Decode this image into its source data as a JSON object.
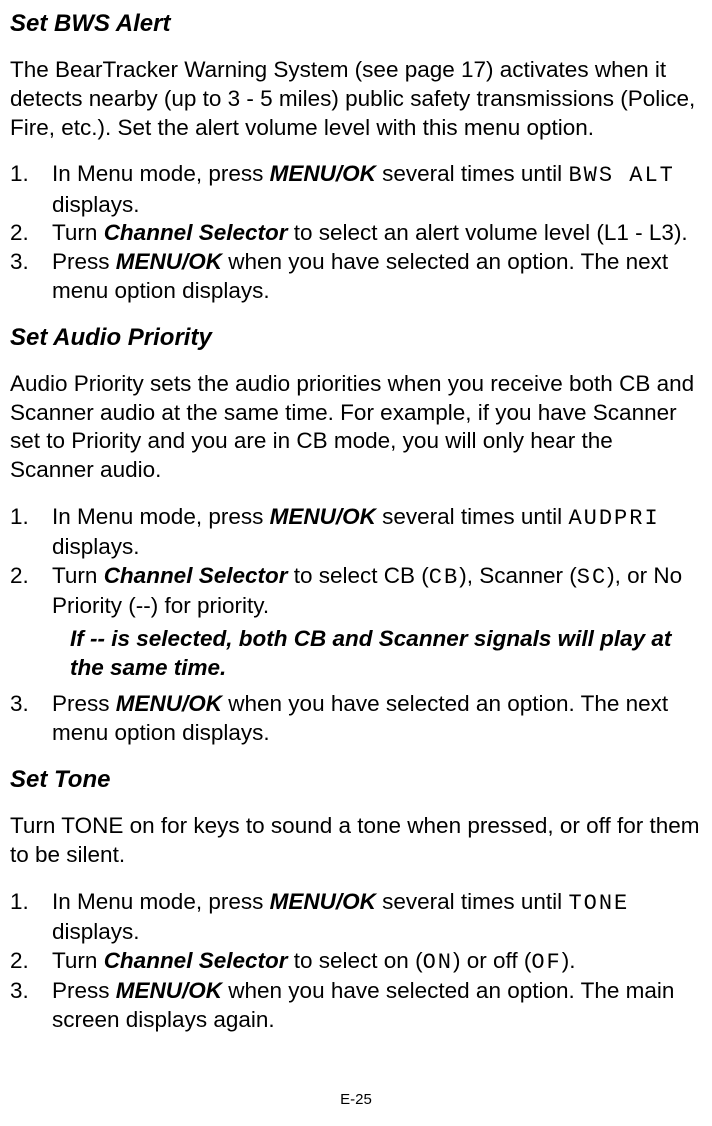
{
  "section1": {
    "heading": "Set BWS Alert",
    "intro": "The BearTracker Warning System (see page 17) activates when it detects nearby (up to 3 - 5 miles) public safety transmissions (Police, Fire, etc.). Set the alert volume level with this menu option.",
    "steps": [
      {
        "num": "1.",
        "pre": "In Menu mode, press ",
        "bi1": "MENU/OK",
        "mid": " several times until ",
        "lcd": "BWS ALT",
        "post": " displays."
      },
      {
        "num": "2.",
        "pre": "Turn ",
        "bi1": "Channel Selector",
        "post": " to select an alert volume level (L1 - L3)."
      },
      {
        "num": "3.",
        "pre": "Press ",
        "bi1": "MENU/OK",
        "post": " when you have selected an option. The next menu option  displays."
      }
    ]
  },
  "section2": {
    "heading": "Set Audio Priority",
    "intro": "Audio Priority sets the audio priorities when you receive both CB and Scanner audio at the same time. For example, if you have Scanner set to Priority and you are in CB mode, you will only hear the Scanner audio.",
    "step1": {
      "num": "1.",
      "pre": "In Menu mode, press ",
      "bi1": "MENU/OK",
      "mid": " several times until ",
      "lcd": "AUDPRI",
      "post": " displays."
    },
    "step2": {
      "num": "2.",
      "pre": "Turn ",
      "bi1": "Channel Selector",
      "mid1": " to select CB (",
      "lcd1": "CB",
      "mid2": "), Scanner (",
      "lcd2": "SC",
      "post": "), or No Priority (--) for priority."
    },
    "note": "If -- is selected, both CB and Scanner signals will play at the same time.",
    "step3": {
      "num": "3.",
      "pre": "Press ",
      "bi1": "MENU/OK",
      "post": " when you have selected an option. The next menu option  displays."
    }
  },
  "section3": {
    "heading": "Set Tone",
    "intro": "Turn TONE on for keys to sound a tone when pressed, or off for them to be silent.",
    "step1": {
      "num": "1.",
      "pre": "In Menu mode, press ",
      "bi1": "MENU/OK",
      "mid": " several times until ",
      "lcd": "TONE",
      "post": "  displays."
    },
    "step2": {
      "num": "2.",
      "pre": "Turn ",
      "bi1": "Channel Selector",
      "mid1": " to select on (",
      "lcd1": "ON",
      "mid2": ") or off (",
      "lcd2": "OF",
      "post": ")."
    },
    "step3": {
      "num": "3.",
      "pre": "Press ",
      "bi1": "MENU/OK",
      "post": " when you have selected an option. The main screen displays again."
    }
  },
  "footer": "E-25"
}
